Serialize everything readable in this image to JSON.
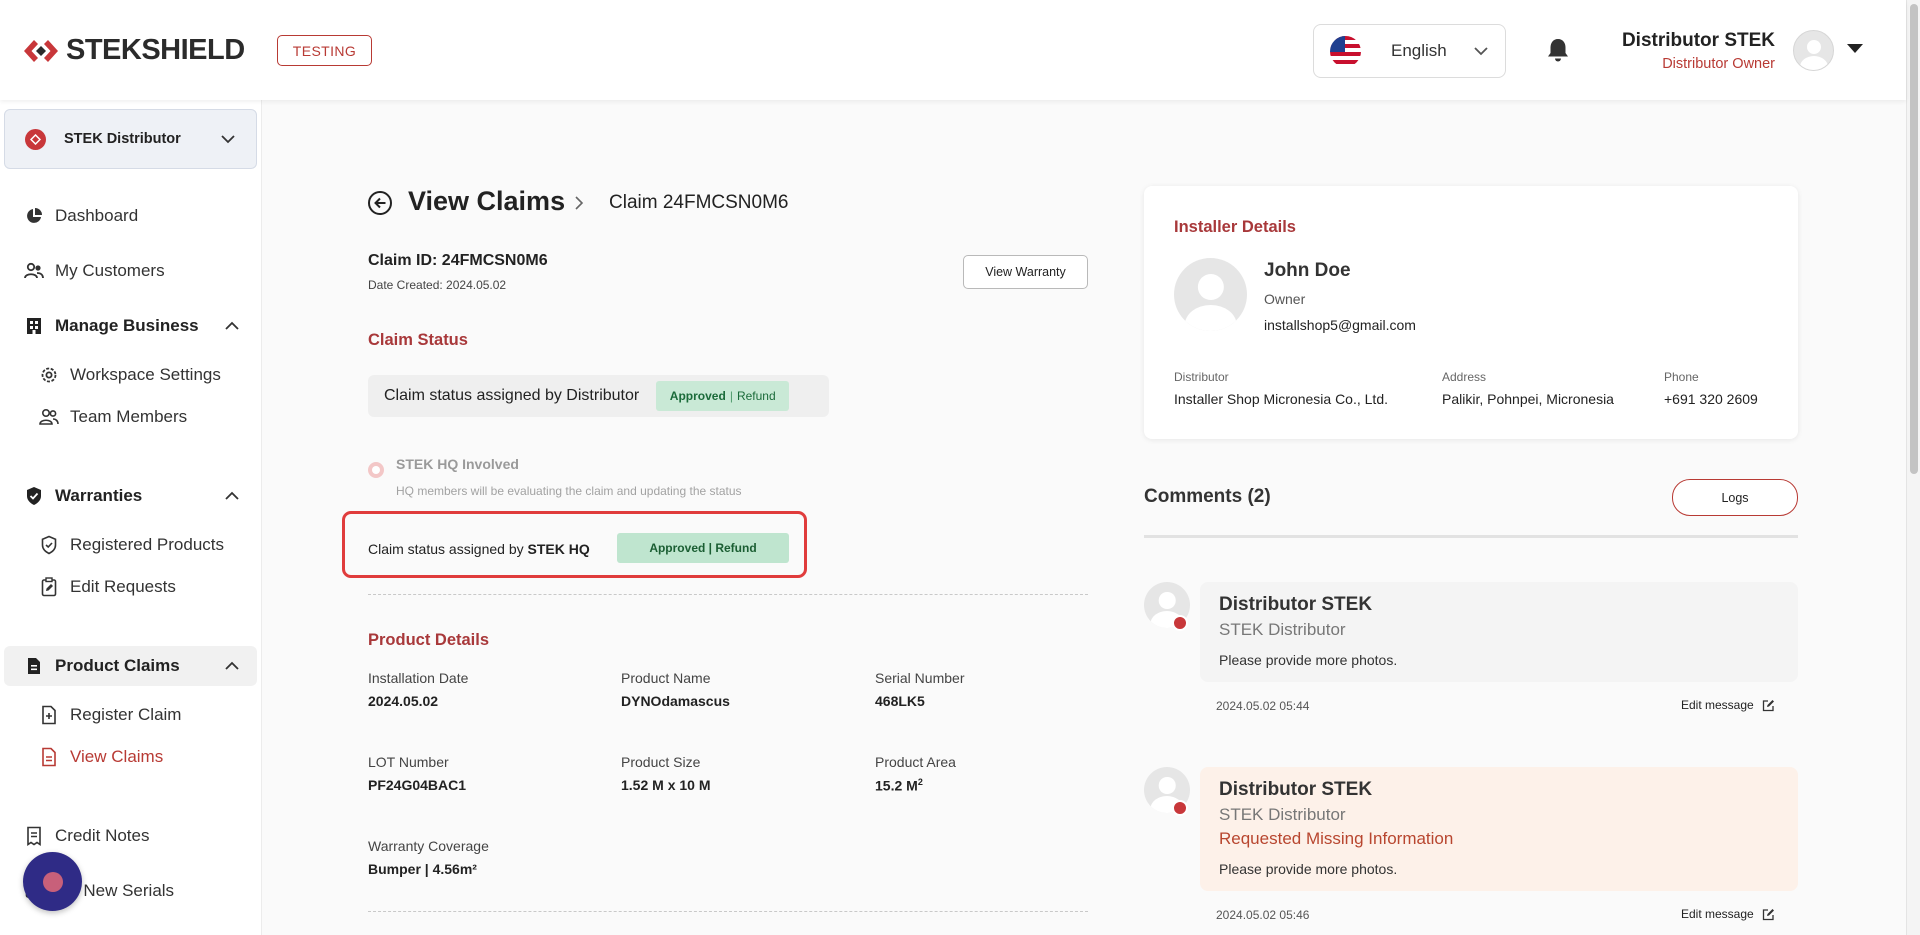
{
  "header": {
    "brand": "STEKSHIELD",
    "environment_badge": "TESTING",
    "language": "English",
    "user_name": "Distributor STEK",
    "user_role": "Distributor Owner"
  },
  "sidebar": {
    "org_name": "STEK Distributor",
    "items": [
      {
        "label": "Dashboard",
        "icon": "pie-chart-icon"
      },
      {
        "label": "My Customers",
        "icon": "users-icon"
      },
      {
        "label": "Manage Business",
        "icon": "building-icon"
      },
      {
        "label": "Workspace Settings",
        "icon": "gear-icon"
      },
      {
        "label": "Team Members",
        "icon": "team-icon"
      },
      {
        "label": "Warranties",
        "icon": "shield-check-icon"
      },
      {
        "label": "Registered Products",
        "icon": "shield-outline-icon"
      },
      {
        "label": "Edit Requests",
        "icon": "clipboard-edit-icon"
      },
      {
        "label": "Product Claims",
        "icon": "document-icon"
      },
      {
        "label": "Register Claim",
        "icon": "document-plus-icon"
      },
      {
        "label": "View Claims",
        "icon": "document-list-icon"
      },
      {
        "label": "Credit Notes",
        "icon": "receipt-icon"
      },
      {
        "label": "ate New Serials",
        "icon": "serial-icon"
      }
    ]
  },
  "main": {
    "title": "View Claims",
    "breadcrumb": "Claim 24FMCSN0M6",
    "claim_id": "Claim ID: 24FMCSN0M6",
    "date_created": "Date Created: 2024.05.02",
    "view_warranty_label": "View Warranty",
    "claim_status_title": "Claim Status",
    "distributor_status_label": "Claim status assigned by Distributor",
    "distributor_status_primary": "Approved",
    "distributor_status_sep": "|",
    "distributor_status_secondary": "Refund",
    "hq_involved_title": "STEK HQ Involved",
    "hq_involved_desc": "HQ members will be evaluating the claim and updating the status",
    "hq_status_prefix": "Claim status assigned by ",
    "hq_status_org": "STEK HQ",
    "hq_status_value": "Approved | Refund",
    "product_details_title": "Product Details",
    "fields": [
      {
        "label": "Installation Date",
        "value": "2024.05.02"
      },
      {
        "label": "Product Name",
        "value": "DYNOdamascus"
      },
      {
        "label": "Serial Number",
        "value": "468LK5"
      },
      {
        "label": "LOT Number",
        "value": "PF24G04BAC1"
      },
      {
        "label": "Product Size",
        "value": "1.52 M x 10 M"
      },
      {
        "label": "Product Area",
        "value": "15.2 M"
      },
      {
        "label": "Warranty Coverage",
        "value": "Bumper | 4.56m²"
      }
    ],
    "product_area_unit_sup": "2"
  },
  "installer": {
    "title": "Installer Details",
    "name": "John Doe",
    "role": "Owner",
    "email": "installshop5@gmail.com",
    "distributor_label": "Distributor",
    "distributor_value": "Installer Shop Micronesia Co., Ltd.",
    "address_label": "Address",
    "address_value": "Palikir, Pohnpei, Micronesia",
    "phone_label": "Phone",
    "phone_value": "+691 320 2609"
  },
  "comments": {
    "title": "Comments (2)",
    "logs_label": "Logs",
    "edit_label": "Edit message",
    "items": [
      {
        "author": "Distributor STEK",
        "org": "STEK Distributor",
        "tag": "",
        "message": "Please provide more photos.",
        "time": "2024.05.02 05:44"
      },
      {
        "author": "Distributor STEK",
        "org": "STEK Distributor",
        "tag": "Requested Missing Information",
        "message": "Please provide more photos.",
        "time": "2024.05.02 05:46"
      }
    ]
  },
  "colors": {
    "brand_red": "#b83a34",
    "success_bg": "#c9e9d6",
    "success_text": "#1b6b3a",
    "highlight_border": "#e03c3c"
  }
}
